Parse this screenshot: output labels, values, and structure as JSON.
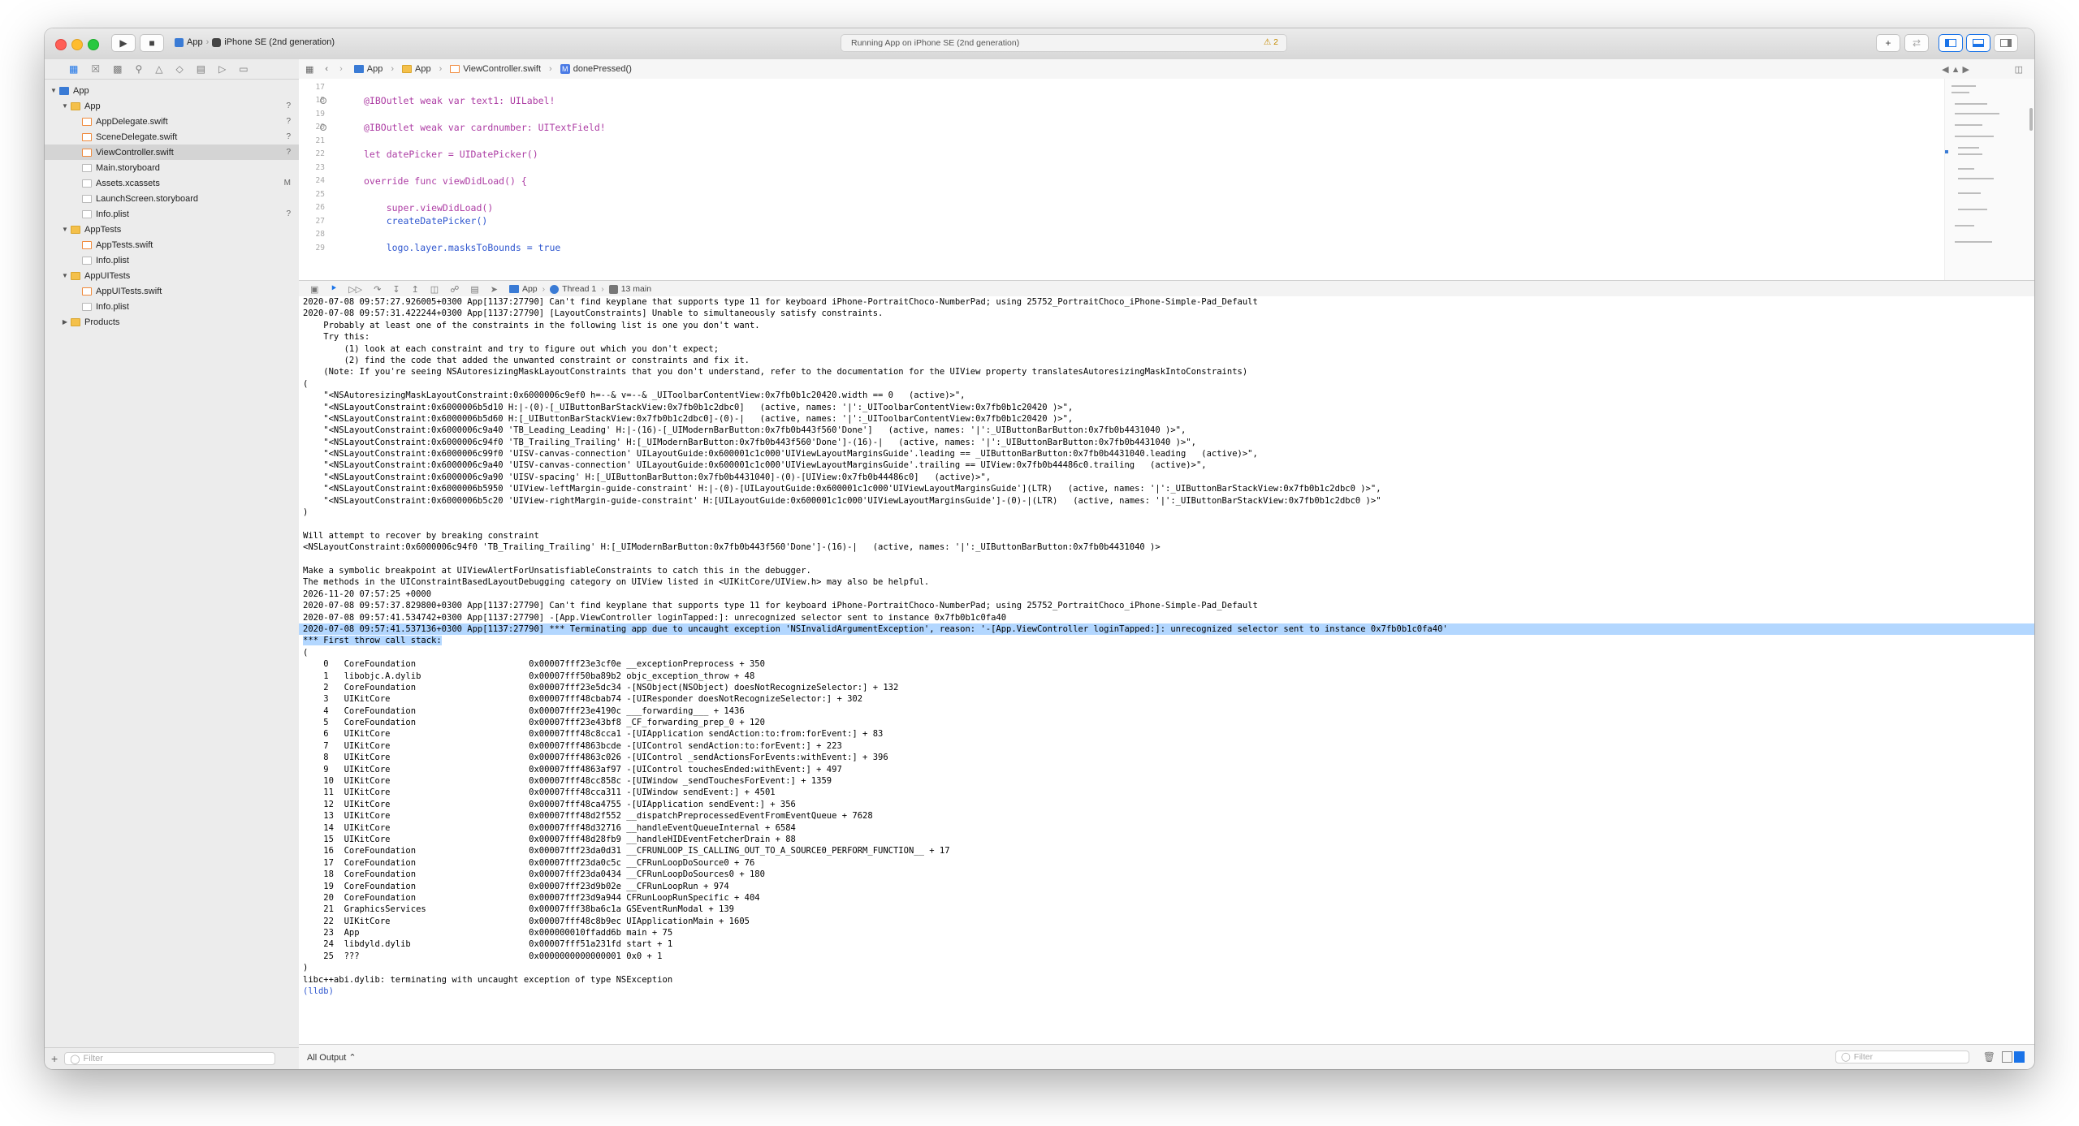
{
  "toolbar": {
    "scheme_app": "App",
    "scheme_device": "iPhone SE (2nd generation)",
    "status": "Running App on iPhone SE (2nd generation)",
    "warnings": "2",
    "run_icon": "play-icon",
    "stop_icon": "stop-icon"
  },
  "navigator": {
    "items": [
      {
        "label": "App",
        "indent": 0,
        "kind": "project",
        "badge": ""
      },
      {
        "label": "App",
        "indent": 1,
        "kind": "folder",
        "badge": "?"
      },
      {
        "label": "AppDelegate.swift",
        "indent": 2,
        "kind": "swift",
        "badge": "?"
      },
      {
        "label": "SceneDelegate.swift",
        "indent": 2,
        "kind": "swift",
        "badge": "?"
      },
      {
        "label": "ViewController.swift",
        "indent": 2,
        "kind": "swift",
        "badge": "?"
      },
      {
        "label": "Main.storyboard",
        "indent": 2,
        "kind": "doc",
        "badge": ""
      },
      {
        "label": "Assets.xcassets",
        "indent": 2,
        "kind": "doc",
        "badge": "M"
      },
      {
        "label": "LaunchScreen.storyboard",
        "indent": 2,
        "kind": "doc",
        "badge": ""
      },
      {
        "label": "Info.plist",
        "indent": 2,
        "kind": "doc",
        "badge": "?"
      },
      {
        "label": "AppTests",
        "indent": 1,
        "kind": "folder",
        "badge": ""
      },
      {
        "label": "AppTests.swift",
        "indent": 2,
        "kind": "swift",
        "badge": ""
      },
      {
        "label": "Info.plist",
        "indent": 2,
        "kind": "doc",
        "badge": ""
      },
      {
        "label": "AppUITests",
        "indent": 1,
        "kind": "folder",
        "badge": ""
      },
      {
        "label": "AppUITests.swift",
        "indent": 2,
        "kind": "swift",
        "badge": ""
      },
      {
        "label": "Info.plist",
        "indent": 2,
        "kind": "doc",
        "badge": ""
      },
      {
        "label": "Products",
        "indent": 1,
        "kind": "folder",
        "badge": ""
      }
    ],
    "filter_placeholder": "Filter"
  },
  "jumpbar": {
    "crumbs": [
      "App",
      "App",
      "ViewController.swift",
      "donePressed()"
    ]
  },
  "editor": {
    "lines": [
      {
        "num": "17",
        "text": ""
      },
      {
        "num": "18",
        "text": "@IBOutlet weak var text1: UILabel!"
      },
      {
        "num": "19",
        "text": ""
      },
      {
        "num": "20",
        "text": "@IBOutlet weak var cardnumber: UITextField!"
      },
      {
        "num": "21",
        "text": ""
      },
      {
        "num": "22",
        "text": "let datePicker = UIDatePicker()"
      },
      {
        "num": "23",
        "text": ""
      },
      {
        "num": "24",
        "text": "override func viewDidLoad() {"
      },
      {
        "num": "25",
        "text": ""
      },
      {
        "num": "26",
        "text": "    super.viewDidLoad()"
      },
      {
        "num": "27",
        "text": "    createDatePicker()"
      },
      {
        "num": "28",
        "text": ""
      },
      {
        "num": "29",
        "text": "    logo.layer.masksToBounds = true"
      }
    ]
  },
  "debugbar": {
    "process": "App",
    "thread": "Thread 1",
    "frame": "13 main"
  },
  "console": {
    "lines": [
      "2020-07-08 09:57:27.926005+0300 App[1137:27790] Can't find keyplane that supports type 11 for keyboard iPhone-PortraitChoco-NumberPad; using 25752_PortraitChoco_iPhone-Simple-Pad_Default",
      "2020-07-08 09:57:31.422244+0300 App[1137:27790] [LayoutConstraints] Unable to simultaneously satisfy constraints.",
      "    Probably at least one of the constraints in the following list is one you don't want.",
      "    Try this:",
      "        (1) look at each constraint and try to figure out which you don't expect;",
      "        (2) find the code that added the unwanted constraint or constraints and fix it.",
      "    (Note: If you're seeing NSAutoresizingMaskLayoutConstraints that you don't understand, refer to the documentation for the UIView property translatesAutoresizingMaskIntoConstraints)",
      "(",
      "    \"<NSAutoresizingMaskLayoutConstraint:0x6000006c9ef0 h=--& v=--& _UIToolbarContentView:0x7fb0b1c20420.width == 0   (active)>\",",
      "    \"<NSLayoutConstraint:0x6000006b5d10 H:|-(0)-[_UIButtonBarStackView:0x7fb0b1c2dbc0]   (active, names: '|':_UIToolbarContentView:0x7fb0b1c20420 )>\",",
      "    \"<NSLayoutConstraint:0x6000006b5d60 H:[_UIButtonBarStackView:0x7fb0b1c2dbc0]-(0)-|   (active, names: '|':_UIToolbarContentView:0x7fb0b1c20420 )>\",",
      "    \"<NSLayoutConstraint:0x6000006c9a40 'TB_Leading_Leading' H:|-(16)-[_UIModernBarButton:0x7fb0b443f560'Done']   (active, names: '|':_UIButtonBarButton:0x7fb0b4431040 )>\",",
      "    \"<NSLayoutConstraint:0x6000006c94f0 'TB_Trailing_Trailing' H:[_UIModernBarButton:0x7fb0b443f560'Done']-(16)-|   (active, names: '|':_UIButtonBarButton:0x7fb0b4431040 )>\",",
      "    \"<NSLayoutConstraint:0x6000006c99f0 'UISV-canvas-connection' UILayoutGuide:0x600001c1c000'UIViewLayoutMarginsGuide'.leading == _UIButtonBarButton:0x7fb0b4431040.leading   (active)>\",",
      "    \"<NSLayoutConstraint:0x6000006c9a40 'UISV-canvas-connection' UILayoutGuide:0x600001c1c000'UIViewLayoutMarginsGuide'.trailing == UIView:0x7fb0b44486c0.trailing   (active)>\",",
      "    \"<NSLayoutConstraint:0x6000006c9a90 'UISV-spacing' H:[_UIButtonBarButton:0x7fb0b4431040]-(0)-[UIView:0x7fb0b44486c0]   (active)>\",",
      "    \"<NSLayoutConstraint:0x6000006b5950 'UIView-leftMargin-guide-constraint' H:|-(0)-[UILayoutGuide:0x600001c1c000'UIViewLayoutMarginsGuide'](LTR)   (active, names: '|':_UIButtonBarStackView:0x7fb0b1c2dbc0 )>\",",
      "    \"<NSLayoutConstraint:0x6000006b5c20 'UIView-rightMargin-guide-constraint' H:[UILayoutGuide:0x600001c1c000'UIViewLayoutMarginsGuide']-(0)-|(LTR)   (active, names: '|':_UIButtonBarStackView:0x7fb0b1c2dbc0 )>\"",
      ")",
      "",
      "Will attempt to recover by breaking constraint",
      "<NSLayoutConstraint:0x6000006c94f0 'TB_Trailing_Trailing' H:[_UIModernBarButton:0x7fb0b443f560'Done']-(16)-|   (active, names: '|':_UIButtonBarButton:0x7fb0b4431040 )>",
      "",
      "Make a symbolic breakpoint at UIViewAlertForUnsatisfiableConstraints to catch this in the debugger.",
      "The methods in the UIConstraintBasedLayoutDebugging category on UIView listed in <UIKitCore/UIView.h> may also be helpful.",
      "2026-11-20 07:57:25 +0000",
      "2020-07-08 09:57:37.829800+0300 App[1137:27790] Can't find keyplane that supports type 11 for keyboard iPhone-PortraitChoco-NumberPad; using 25752_PortraitChoco_iPhone-Simple-Pad_Default",
      "2020-07-08 09:57:41.534742+0300 App[1137:27790] -[App.ViewController loginTapped:]: unrecognized selector sent to instance 0x7fb0b1c0fa40"
    ],
    "exception_prefix": "2020-07-08 09:57:41.537136+0300 App[1137:27790] *** Terminating app due to uncaught exception 'NSInvalidArgumentException', reason: '-[App.ViewController loginTapped:]: ",
    "exception_selected": "unrecognized selector sent to instance 0x7fb0b1c0fa40'",
    "callstack_title": "*** First throw call stack:",
    "callstack_open": "(",
    "frames": [
      "    0   CoreFoundation                      0x00007fff23e3cf0e __exceptionPreprocess + 350",
      "    1   libobjc.A.dylib                     0x00007fff50ba89b2 objc_exception_throw + 48",
      "    2   CoreFoundation                      0x00007fff23e5dc34 -[NSObject(NSObject) doesNotRecognizeSelector:] + 132",
      "    3   UIKitCore                           0x00007fff48cbab74 -[UIResponder doesNotRecognizeSelector:] + 302",
      "    4   CoreFoundation                      0x00007fff23e4190c ___forwarding___ + 1436",
      "    5   CoreFoundation                      0x00007fff23e43bf8 _CF_forwarding_prep_0 + 120",
      "    6   UIKitCore                           0x00007fff48c8cca1 -[UIApplication sendAction:to:from:forEvent:] + 83",
      "    7   UIKitCore                           0x00007fff4863bcde -[UIControl sendAction:to:forEvent:] + 223",
      "    8   UIKitCore                           0x00007fff4863c026 -[UIControl _sendActionsForEvents:withEvent:] + 396",
      "    9   UIKitCore                           0x00007fff4863af97 -[UIControl touchesEnded:withEvent:] + 497",
      "    10  UIKitCore                           0x00007fff48cc858c -[UIWindow _sendTouchesForEvent:] + 1359",
      "    11  UIKitCore                           0x00007fff48cca311 -[UIWindow sendEvent:] + 4501",
      "    12  UIKitCore                           0x00007fff48ca4755 -[UIApplication sendEvent:] + 356",
      "    13  UIKitCore                           0x00007fff48d2f552 __dispatchPreprocessedEventFromEventQueue + 7628",
      "    14  UIKitCore                           0x00007fff48d32716 __handleEventQueueInternal + 6584",
      "    15  UIKitCore                           0x00007fff48d28fb9 __handleHIDEventFetcherDrain + 88",
      "    16  CoreFoundation                      0x00007fff23da0d31 __CFRUNLOOP_IS_CALLING_OUT_TO_A_SOURCE0_PERFORM_FUNCTION__ + 17",
      "    17  CoreFoundation                      0x00007fff23da0c5c __CFRunLoopDoSource0 + 76",
      "    18  CoreFoundation                      0x00007fff23da0434 __CFRunLoopDoSources0 + 180",
      "    19  CoreFoundation                      0x00007fff23d9b02e __CFRunLoopRun + 974",
      "    20  CoreFoundation                      0x00007fff23d9a944 CFRunLoopRunSpecific + 404",
      "    21  GraphicsServices                    0x00007fff38ba6c1a GSEventRunModal + 139",
      "    22  UIKitCore                           0x00007fff48c8b9ec UIApplicationMain + 1605",
      "    23  App                                 0x000000010ffadd6b main + 75",
      "    24  libdyld.dylib                       0x00007fff51a231fd start + 1",
      "    25  ???                                 0x0000000000000001 0x0 + 1"
    ],
    "callstack_close": ")",
    "terminating": "libc++abi.dylib: terminating with uncaught exception of type NSException",
    "prompt": "(lldb)"
  },
  "footer": {
    "output_selector": "All Output ⌃",
    "filter_placeholder": "Filter"
  },
  "colors": {
    "selection": "#b3d7ff",
    "accent": "#1a73e8"
  }
}
